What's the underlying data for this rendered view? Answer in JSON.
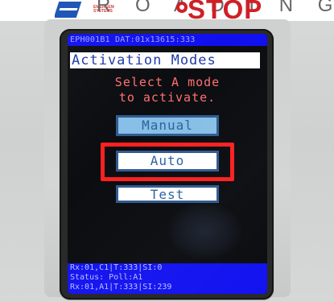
{
  "header": {
    "partial_text": "R O A D I N G   S A F E T",
    "small_logo_text": "EMERGENCY SYSTEMS",
    "brand_text": "STOP"
  },
  "device": {
    "status_top": "EPH001B1 DAT:01x13615:333",
    "screen_title": "Activation Modes",
    "prompt_line_1": "Select A mode",
    "prompt_line_2": "to activate.",
    "buttons": {
      "manual": "Manual",
      "auto": "Auto",
      "test": "Test"
    },
    "bottom_status": [
      "Rx:01,C1|T:333|SI:0",
      "Status: Poll:A1",
      "Rx:01,A1|T:333|SI:239"
    ]
  }
}
